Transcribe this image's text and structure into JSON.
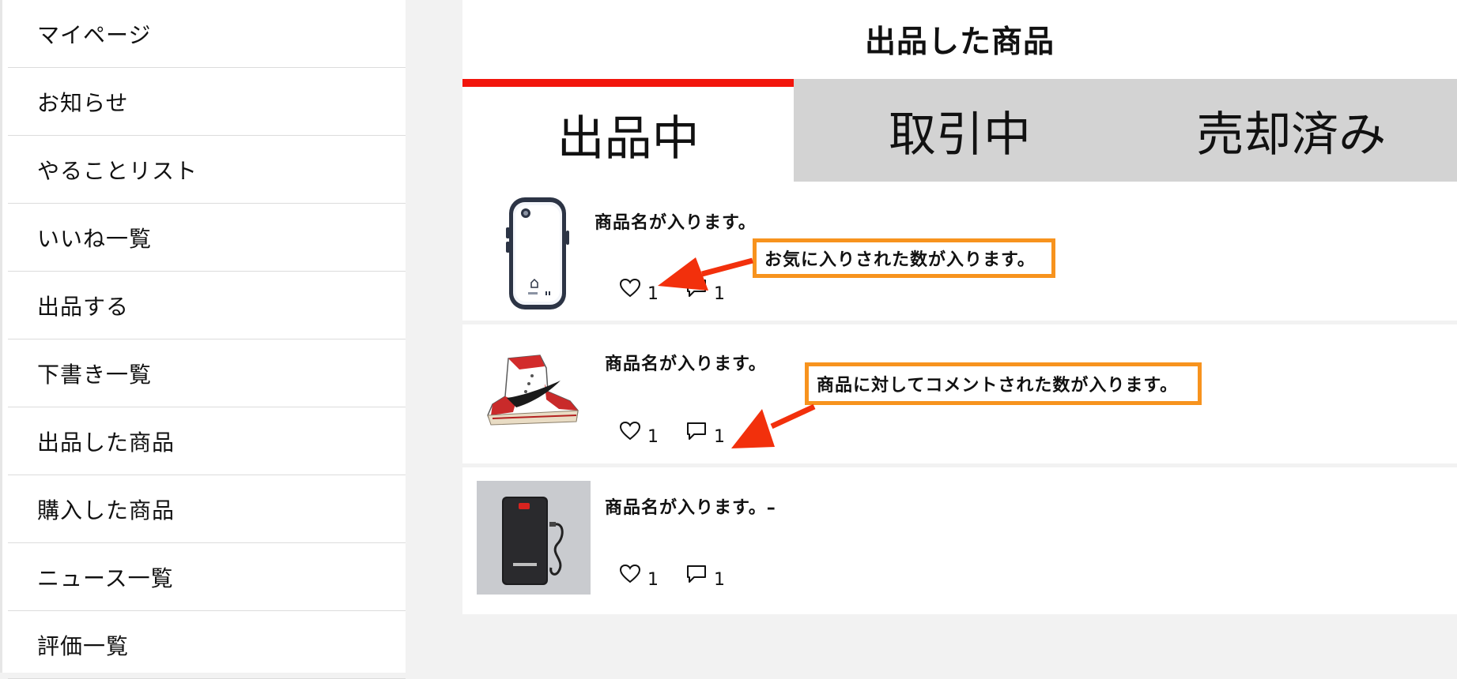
{
  "sidebar": {
    "items": [
      {
        "label": "マイページ"
      },
      {
        "label": "お知らせ"
      },
      {
        "label": "やることリスト"
      },
      {
        "label": "いいね一覧"
      },
      {
        "label": "出品する"
      },
      {
        "label": "下書き一覧"
      },
      {
        "label": "出品した商品"
      },
      {
        "label": "購入した商品"
      },
      {
        "label": "ニュース一覧"
      },
      {
        "label": "評価一覧"
      }
    ]
  },
  "main": {
    "title": "出品した商品",
    "tabs": [
      {
        "label": "出品中",
        "active": true
      },
      {
        "label": "取引中",
        "active": false
      },
      {
        "label": "売却済み",
        "active": false
      }
    ],
    "items": [
      {
        "name": "商品名が入ります。",
        "image": "phone-case-image",
        "likes": "1",
        "comments": "1"
      },
      {
        "name": "商品名が入ります。",
        "image": "sneaker-image",
        "likes": "1",
        "comments": "1"
      },
      {
        "name": "商品名が入ります。–",
        "image": "power-bank-image",
        "likes": "1",
        "comments": "1"
      }
    ]
  },
  "annotations": {
    "likes_note": "お気に入りされた数が入ります。",
    "comments_note": "商品に対してコメントされた数が入ります。"
  },
  "colors": {
    "accent": "#f2150c",
    "inactive_tab": "#d3d3d3",
    "callout_border": "#f7931e",
    "arrow": "#f2300c",
    "page_background": "#f2f2f2"
  }
}
